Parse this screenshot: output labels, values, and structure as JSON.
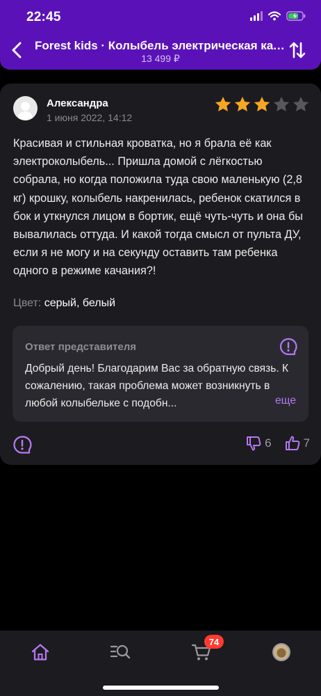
{
  "status_bar": {
    "time": "22:45"
  },
  "header": {
    "title": "Forest kids · Колыбель электрическая качалка",
    "price": "13 499 ₽"
  },
  "review": {
    "author": "Александра",
    "date": "1 июня 2022, 14:12",
    "rating": 3,
    "rating_max": 5,
    "text": "Красивая и стильная кроватка, но я брала её как электроколыбель... Пришла домой с лёгкостью собрала, но когда положила туда свою маленькую (2,8 кг) крошку, колыбель накренилась, ребенок скатился в бок и уткнулся лицом в бортик, ещё чуть-чуть и она бы вывалилась оттуда. И какой тогда смысл от пульта ДУ, если я не могу и на секунду оставить там ребенка одного в режиме качания?!",
    "color_label": "Цвет:",
    "color_value": "серый, белый",
    "reply": {
      "title": "Ответ представителя",
      "text": "Добрый день! Благодарим Вас за обратную связь. К сожалению, такая проблема может возникнуть в любой колыбельке с подобн...",
      "more": "еще"
    },
    "dislikes": "6",
    "likes": "7"
  },
  "tabbar": {
    "cart_count": "74",
    "items": [
      "home-icon",
      "catalog-search-icon",
      "cart-icon",
      "profile-avatar"
    ]
  },
  "colors": {
    "header": "#5a12b8",
    "accent": "#b479f2",
    "star_active": "#f5a623",
    "star_inactive": "#58575d",
    "badge": "#ff3b30",
    "card": "#1c1b1f"
  }
}
